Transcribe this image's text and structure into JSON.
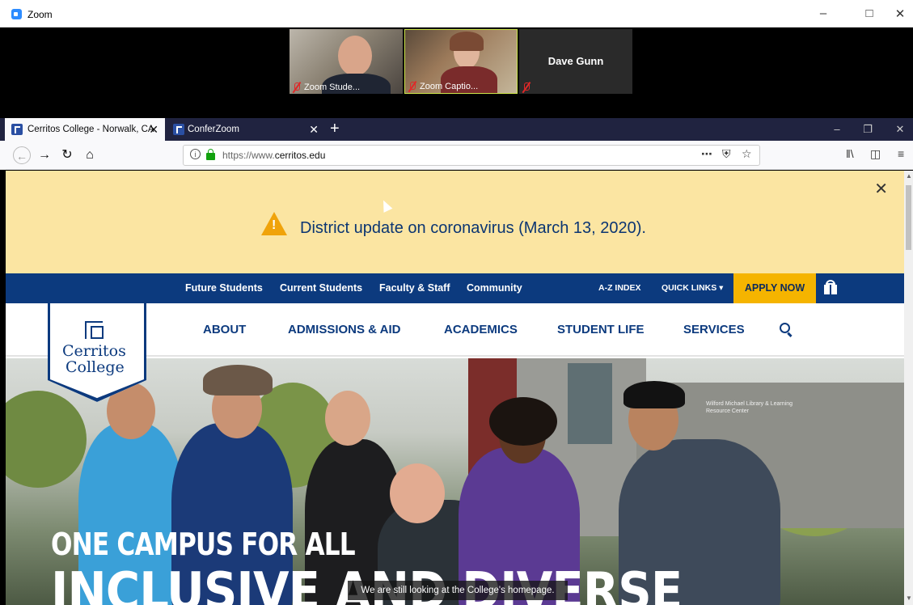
{
  "zoom": {
    "title": "Zoom",
    "participants": [
      {
        "name": "Zoom Stude..."
      },
      {
        "name": "Zoom Captio..."
      },
      {
        "name": "Dave Gunn"
      }
    ]
  },
  "browser": {
    "tabs": [
      {
        "label": "Cerritos College - Norwalk, CA",
        "active": true
      },
      {
        "label": "ConferZoom",
        "active": false
      }
    ],
    "url_prefix": "https://www.",
    "url_domain": "cerritos.edu"
  },
  "page": {
    "alert": {
      "text": "District update on coronavirus (March 13, 2020)."
    },
    "utility_nav": [
      "Future Students",
      "Current Students",
      "Faculty & Staff",
      "Community"
    ],
    "az_index": "A-Z INDEX",
    "quick_links": "QUICK LINKS",
    "apply": "APPLY NOW",
    "main_nav": [
      "ABOUT",
      "ADMISSIONS & AID",
      "ACADEMICS",
      "STUDENT LIFE",
      "SERVICES"
    ],
    "logo_line1": "Cerritos",
    "logo_line2": "College",
    "hero_line1": "ONE CAMPUS FOR ALL",
    "hero_line2": "INCLUSIVE AND DIVERSE",
    "building_sign": "Wilford Michael Library & Learning Resource Center"
  },
  "caption": "We are still looking at the College's homepage.",
  "colors": {
    "navy": "#0c3a7e",
    "alert": "#fbe5a2",
    "apply": "#f5b400"
  }
}
